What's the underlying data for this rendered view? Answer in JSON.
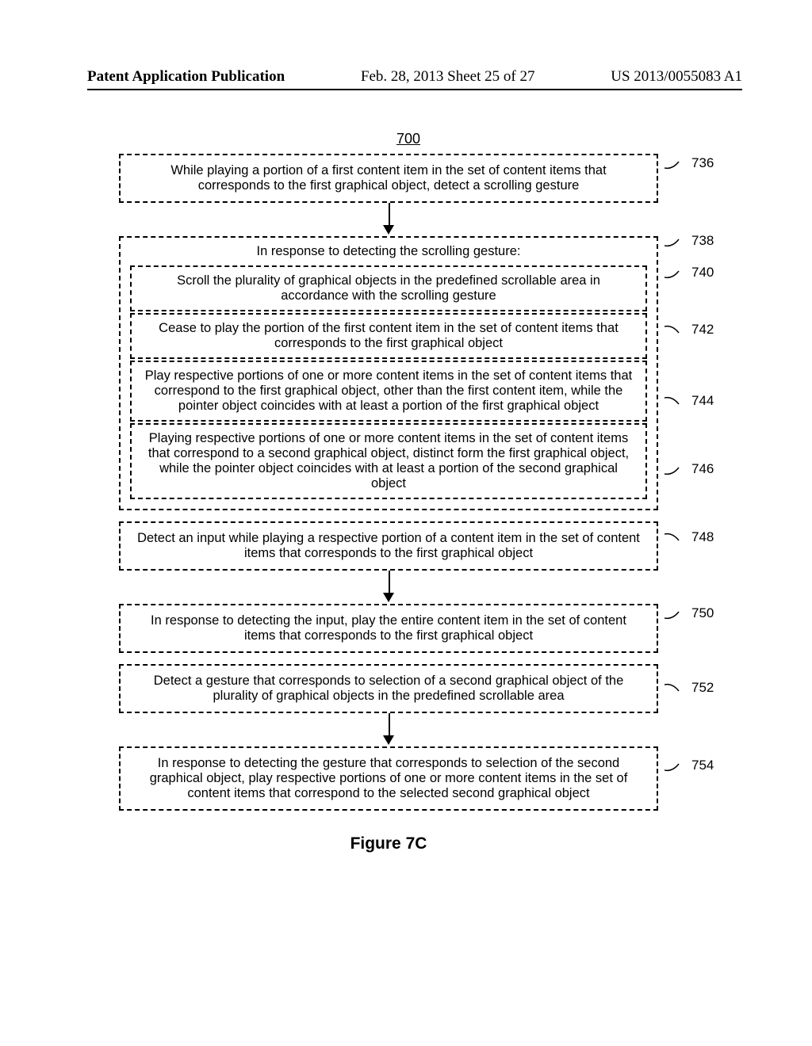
{
  "header": {
    "left": "Patent Application Publication",
    "center": "Feb. 28, 2013  Sheet 25 of 27",
    "right": "US 2013/0055083 A1"
  },
  "figure_number": "700",
  "boxes": {
    "b736": {
      "ref": "736",
      "text": "While playing a portion of a first content item in the set of content items that corresponds to the first graphical object, detect a scrolling gesture"
    },
    "b738": {
      "ref": "738",
      "title": "In response to detecting the scrolling gesture:"
    },
    "b740": {
      "ref": "740",
      "text": "Scroll the plurality of graphical objects in the predefined scrollable area in accordance with the scrolling gesture"
    },
    "b742": {
      "ref": "742",
      "text": "Cease to play the portion of the first content item in the set of content items that corresponds to the first graphical object"
    },
    "b744": {
      "ref": "744",
      "text": "Play respective portions of one or more content items in the set of content items that correspond to the first graphical object, other than the first content item, while the pointer object coincides with at least a portion of the first graphical object"
    },
    "b746": {
      "ref": "746",
      "text": "Playing respective portions of one or more content items in the set of content items that correspond to a second graphical object, distinct form the first graphical object, while the pointer object coincides with at least a portion of the second graphical object"
    },
    "b748": {
      "ref": "748",
      "text": "Detect an input while playing a respective portion of a content item in the set of content items that corresponds to the first graphical object"
    },
    "b750": {
      "ref": "750",
      "text": "In response to detecting the input, play the entire content item in the set of content items that corresponds to the first graphical object"
    },
    "b752": {
      "ref": "752",
      "text": "Detect a gesture that corresponds to selection of a second graphical object of the plurality of graphical objects in the predefined scrollable area"
    },
    "b754": {
      "ref": "754",
      "text": "In response to detecting the gesture that corresponds to selection of the second graphical object, play respective portions of one or more content items in the set of content items that correspond to the selected second graphical object"
    }
  },
  "caption": "Figure 7C"
}
